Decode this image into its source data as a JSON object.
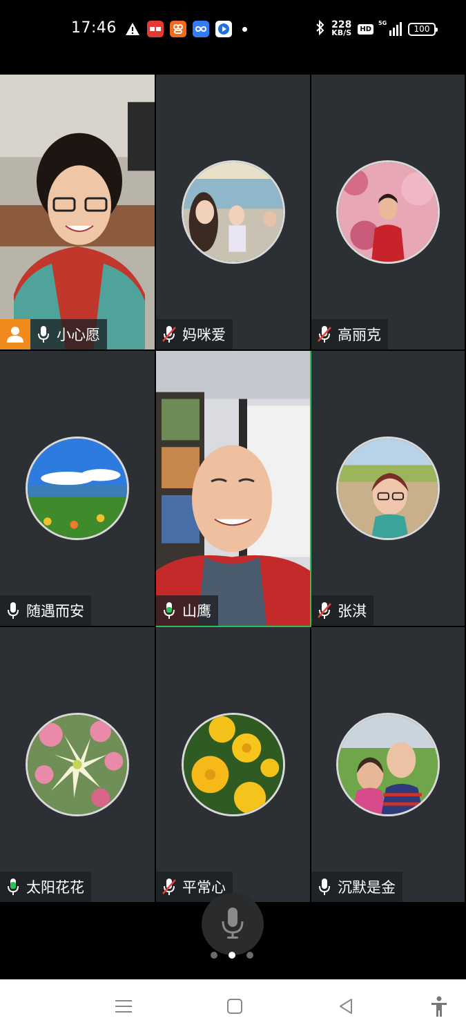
{
  "status_bar": {
    "time": "17:46",
    "notifications": [
      "warning-icon",
      "toutiao-icon",
      "app-orange-icon",
      "app-infinity-icon",
      "app-blue-icon"
    ],
    "net_speed_value": "228",
    "net_speed_unit": "KB/S",
    "hd_label": "HD",
    "network_label": "5G",
    "battery_level": "100"
  },
  "participants": [
    {
      "name": "小心愿",
      "mic": "on",
      "host": true,
      "video": true
    },
    {
      "name": "妈咪爱",
      "mic": "muted",
      "host": false,
      "video": false
    },
    {
      "name": "高丽克",
      "mic": "muted",
      "host": false,
      "video": false
    },
    {
      "name": "随遇而安",
      "mic": "on",
      "host": false,
      "video": false
    },
    {
      "name": "山鹰",
      "mic": "speaking",
      "host": false,
      "video": true
    },
    {
      "name": "张淇",
      "mic": "muted",
      "host": false,
      "video": false
    },
    {
      "name": "太阳花花",
      "mic": "speaking",
      "host": false,
      "video": false
    },
    {
      "name": "平常心",
      "mic": "muted",
      "host": false,
      "video": false
    },
    {
      "name": "沉默是金",
      "mic": "on",
      "host": false,
      "video": false
    }
  ],
  "pager": {
    "pages": 3,
    "current": 2
  },
  "colors": {
    "speaking": "#2fbf58",
    "muted": "#e5403a",
    "host_badge": "#f08a1c",
    "tile_bg": "#2c2f33"
  },
  "nav_icons": [
    "menu-icon",
    "home-icon",
    "back-icon",
    "accessibility-icon"
  ]
}
